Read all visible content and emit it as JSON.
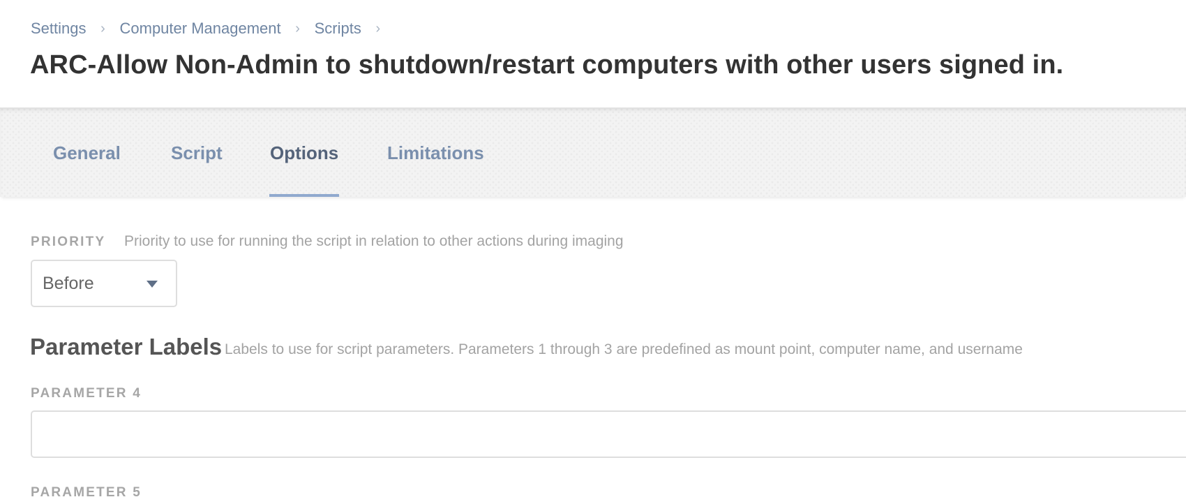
{
  "breadcrumb": {
    "items": [
      "Settings",
      "Computer Management",
      "Scripts"
    ],
    "separator": "›"
  },
  "page": {
    "title": "ARC-Allow Non-Admin to shutdown/restart computers with other users signed in."
  },
  "tabs": [
    {
      "label": "General",
      "active": false
    },
    {
      "label": "Script",
      "active": false
    },
    {
      "label": "Options",
      "active": true
    },
    {
      "label": "Limitations",
      "active": false
    }
  ],
  "priority": {
    "label": "PRIORITY",
    "help": "Priority to use for running the script in relation to other actions during imaging",
    "selected": "Before"
  },
  "parameter_labels": {
    "heading": "Parameter Labels",
    "help": "Labels to use for script parameters. Parameters 1 through 3 are predefined as mount point, computer name, and username",
    "parameter4": {
      "label": "PARAMETER 4",
      "value": ""
    },
    "parameter5": {
      "label": "PARAMETER 5"
    }
  },
  "icons": {
    "breadcrumb_separator": "chevron-right-icon",
    "select_caret": "caret-down-icon"
  },
  "colors": {
    "link": "#6f85a2",
    "active_tab_underline": "#90a9ce",
    "title": "#333333"
  }
}
